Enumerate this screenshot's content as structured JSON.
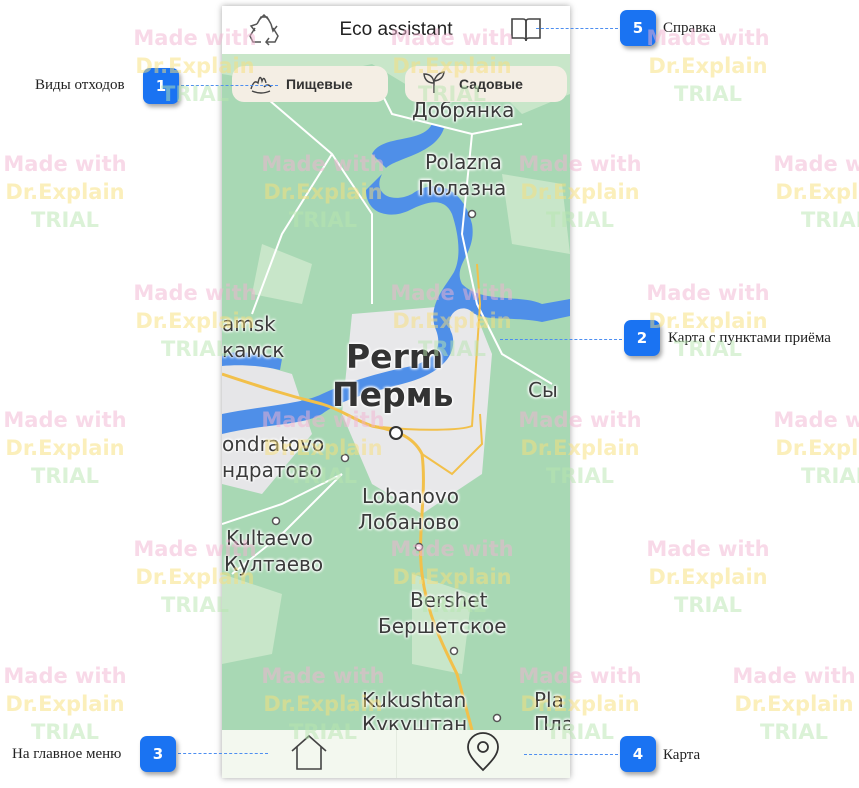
{
  "app": {
    "title": "Eco assistant"
  },
  "icons": {
    "recycle": "recycle-icon",
    "help": "book-icon",
    "food": "food-waste-icon",
    "garden": "plant-icon",
    "home": "home-icon",
    "map": "map-pin-icon"
  },
  "filters": [
    {
      "label": "Пищевые"
    },
    {
      "label": "Садовые"
    }
  ],
  "map": {
    "labels": [
      "Добрянка",
      "Polazna",
      "Полазна",
      "amsk",
      "камск",
      "Perm",
      "Пермь",
      "Cы",
      "ondratovo",
      "ндратово",
      "Lobanovo",
      "Лобаново",
      "Kultaevo",
      "Култаево",
      "Bershet",
      "Бершетское",
      "Kukushtan",
      "Кукуштан",
      "Pla",
      "Пла"
    ]
  },
  "callouts": [
    {
      "number": "1",
      "text": "Виды отходов"
    },
    {
      "number": "2",
      "text": "Карта с пунктами приёма"
    },
    {
      "number": "3",
      "text": "На главное меню"
    },
    {
      "number": "4",
      "text": "Карта"
    },
    {
      "number": "5",
      "text": "Справка"
    }
  ],
  "watermark": {
    "line1": "Made with",
    "line2": "Dr.Explain",
    "line3": "TRIAL"
  },
  "colors": {
    "accent": "#1a73f2",
    "map_land": "#a8d8b4",
    "map_water": "#4f8fe8",
    "road": "#f2c04a"
  }
}
